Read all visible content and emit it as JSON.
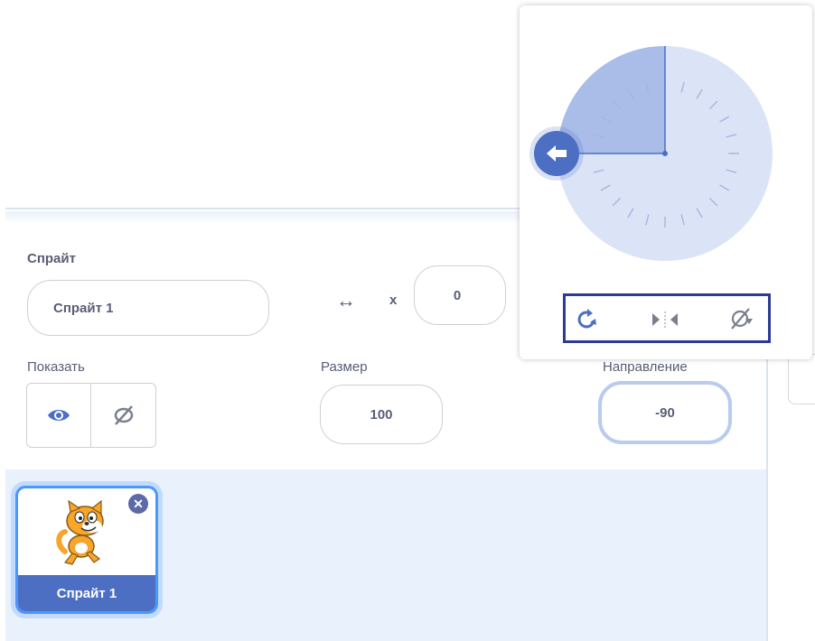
{
  "sprite_info": {
    "sprite_label": "Спрайт",
    "sprite_name_value": "Спрайт 1",
    "x_label": "x",
    "x_value": "0",
    "show_label": "Показать",
    "size_label": "Размер",
    "size_value": "100",
    "direction_label": "Направление",
    "direction_value": "-90"
  },
  "sprite_list": {
    "tiles": [
      {
        "label": "Спрайт 1"
      }
    ]
  },
  "direction_popover": {
    "direction_degrees": -90,
    "rotation_modes": [
      "all-around-icon",
      "left-right-icon",
      "dont-rotate-icon"
    ]
  },
  "colors": {
    "accent": "#4c97ff",
    "selected_tile_label_bg": "#4c6fc4",
    "dial_background": "#dbe4f7",
    "dial_sector": "#a9bde8",
    "handle": "#4c6fc4",
    "highlight_box": "#2c3a96"
  }
}
